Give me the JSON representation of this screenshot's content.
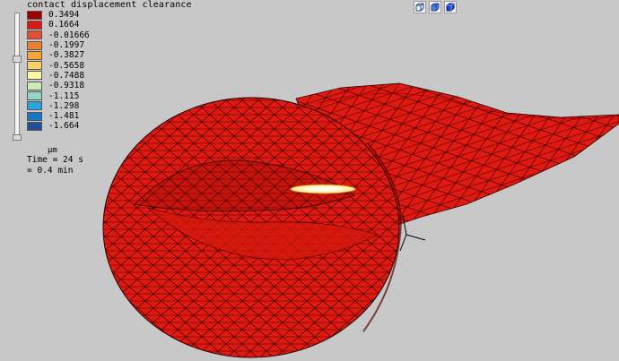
{
  "legend": {
    "title": "contact displacement clearance",
    "items": [
      {
        "label": "0.3494",
        "color": "#a00000"
      },
      {
        "label": "0.1664",
        "color": "#d81a10"
      },
      {
        "label": "-0.01666",
        "color": "#ea4b33"
      },
      {
        "label": "-0.1997",
        "color": "#f07e2e"
      },
      {
        "label": "-0.3827",
        "color": "#f7a53b"
      },
      {
        "label": "-0.5658",
        "color": "#fcd260"
      },
      {
        "label": "-0.7488",
        "color": "#fff6a6"
      },
      {
        "label": "-0.9318",
        "color": "#ccebb8"
      },
      {
        "label": "-1.115",
        "color": "#8fd7c6"
      },
      {
        "label": "-1.298",
        "color": "#27a7dd"
      },
      {
        "label": "-1.481",
        "color": "#1778c5"
      },
      {
        "label": "-1.664",
        "color": "#1f4f98"
      }
    ],
    "units": "µm"
  },
  "time": {
    "line1": "Time = 24 s",
    "line2": "= 0.4 min"
  },
  "view_icons": [
    "wireframe-cube-icon",
    "shaded-cube-icon",
    "solid-cube-icon"
  ],
  "colors": {
    "background": "#c8c8c8",
    "mesh_fill": "#e01a12",
    "mesh_dark": "#c01010",
    "mesh_edge": "#1a0000",
    "contact_highlight": "#fff6a6"
  }
}
